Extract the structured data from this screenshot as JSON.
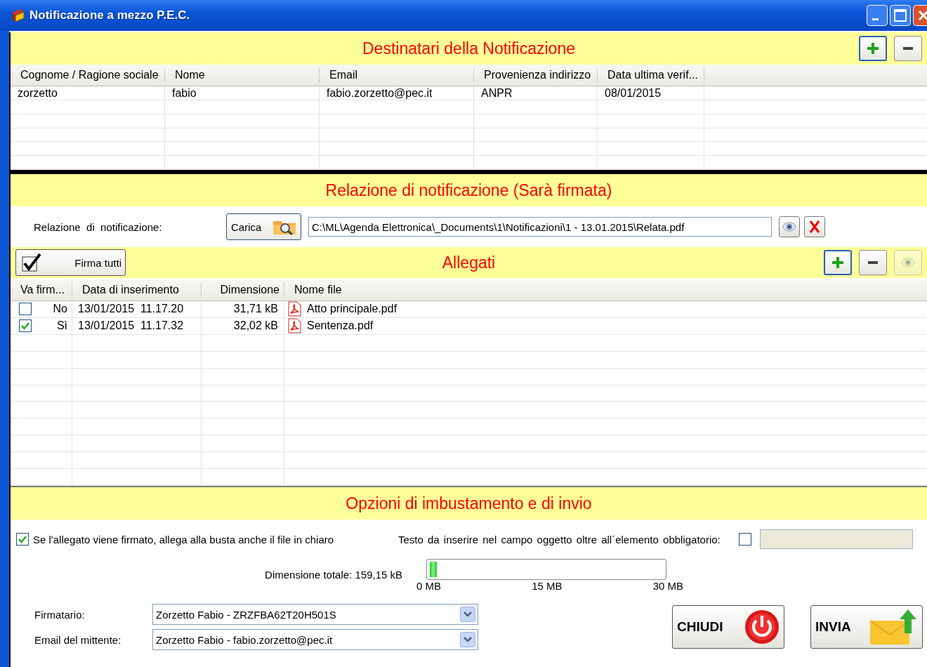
{
  "window": {
    "title": "Notificazione a mezzo P.E.C."
  },
  "recipients": {
    "title": "Destinatari della Notificazione",
    "buttons": [
      {
        "kind": "add",
        "disabled": false
      },
      {
        "kind": "remove",
        "disabled": false
      }
    ],
    "columns": [
      "Cognome / Ragione sociale",
      "Nome",
      "Email",
      "Provenienza indirizzo",
      "Data ultima verif..."
    ],
    "rows": [
      [
        "zorzetto",
        "fabio",
        "fabio.zorzetto@pec.it",
        "ANPR",
        "08/01/2015"
      ]
    ]
  },
  "report": {
    "title": "Relazione di notificazione (Sarà firmata)",
    "label": "Relazione  di  notificazione:",
    "load_button": "Carica",
    "path": "C:\\ML\\Agenda Elettronica\\_Documents\\1\\Notificazioni\\1 - 13.01.2015\\Relata.pdf"
  },
  "attachments": {
    "title": "Allegati",
    "sign_all": {
      "label": "Firma tutti",
      "checked": true
    },
    "buttons": [
      {
        "kind": "add",
        "disabled": false
      },
      {
        "kind": "remove",
        "disabled": false
      },
      {
        "kind": "view",
        "disabled": true
      }
    ],
    "columns": [
      "Va firm...",
      "Data di inserimento",
      "Dimensione",
      "Nome file"
    ],
    "rows": [
      {
        "checked": false,
        "sign": "No",
        "date": "13/01/2015  11.17.20",
        "size": "31,71 kB",
        "file": "Atto principale.pdf"
      },
      {
        "checked": true,
        "sign": "Sì",
        "date": "13/01/2015  11.17.32",
        "size": "32,02 kB",
        "file": "Sentenza.pdf"
      }
    ]
  },
  "options": {
    "title": "Opzioni di imbustamento e di invio",
    "attach_clear": {
      "label": "Se l'allegato viene firmato, allega alla busta anche il file in chiaro",
      "checked": true
    },
    "subject": {
      "label": "Testo da inserire nel campo oggetto oltre all´elemento obbligatorio:",
      "checked": false
    },
    "total": {
      "label": "Dimensione totale: 159,15 kB",
      "level": 0.03,
      "ticks": [
        "0 MB",
        "15 MB",
        "30 MB"
      ]
    },
    "signer": {
      "label": "Firmatario:",
      "value": "Zorzetto Fabio - ZRZFBA62T20H501S"
    },
    "sender": {
      "label": "Email del mittente:",
      "value": "Zorzetto Fabio - fabio.zorzetto@pec.it"
    },
    "buttons": [
      {
        "kind": "close",
        "label": "CHIUDI"
      },
      {
        "kind": "send",
        "label": "INVIA"
      }
    ]
  }
}
